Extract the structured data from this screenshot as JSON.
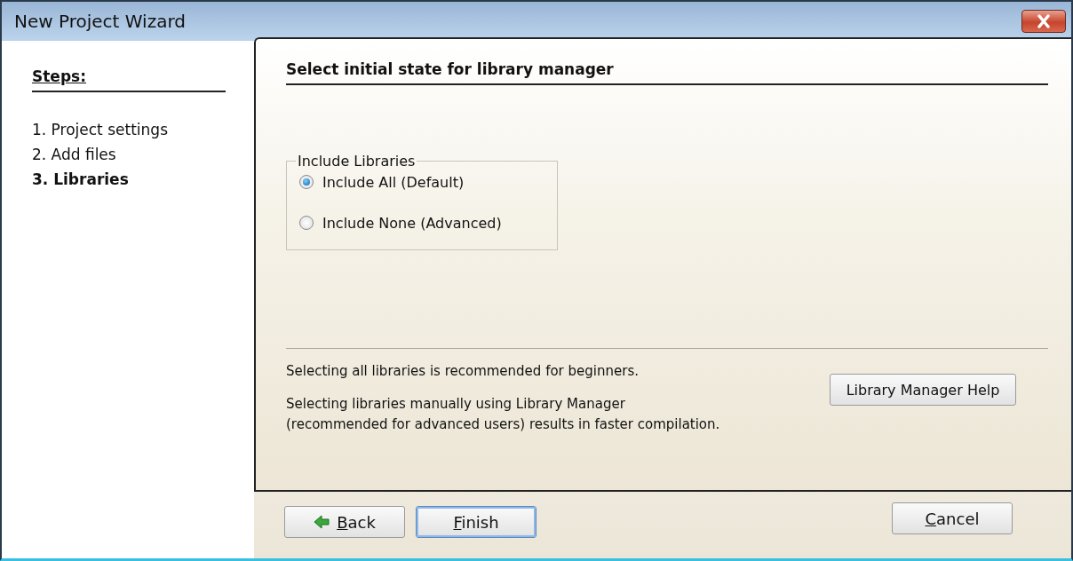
{
  "window": {
    "title": "New Project Wizard"
  },
  "steps": {
    "heading": "Steps:",
    "items": [
      {
        "label": "1. Project settings",
        "selected": false
      },
      {
        "label": "2. Add files",
        "selected": false
      },
      {
        "label": "3. Libraries",
        "selected": true
      }
    ]
  },
  "page": {
    "heading": "Select initial state for library manager",
    "group": {
      "legend": "Include Libraries",
      "options": [
        {
          "label": "Include All (Default)",
          "selected": true
        },
        {
          "label": "Include None (Advanced)",
          "selected": false
        }
      ]
    },
    "notes": [
      "Selecting all libraries is recommended for beginners.",
      "Selecting libraries manually using Library Manager\n(recommended for advanced users) results in faster compilation."
    ],
    "help_button": "Library Manager Help"
  },
  "buttons": {
    "back": "Back",
    "finish": "Finish",
    "cancel": "Cancel"
  }
}
